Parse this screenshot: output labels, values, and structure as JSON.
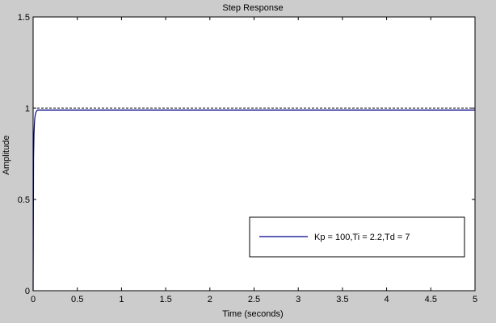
{
  "chart_data": {
    "type": "line",
    "title": "Step Response",
    "xlabel": "Time (seconds)",
    "ylabel": "Amplitude",
    "xlim": [
      0,
      5
    ],
    "ylim": [
      0,
      1.5
    ],
    "xticks": [
      0,
      0.5,
      1,
      1.5,
      2,
      2.5,
      3,
      3.5,
      4,
      4.5,
      5
    ],
    "xtick_labels": [
      "0",
      "0.5",
      "1",
      "1.5",
      "2",
      "2.5",
      "3",
      "3.5",
      "4",
      "4.5",
      "5"
    ],
    "yticks": [
      0,
      0.5,
      1,
      1.5
    ],
    "ytick_labels": [
      "0",
      "0.5",
      "1",
      "1.5"
    ],
    "grid": false,
    "legend_position": "lower-right",
    "reference_line": {
      "y": 1,
      "style": "dashed",
      "color": "#000000"
    },
    "series": [
      {
        "name": "Kp = 100,Ti = 2.2,Td = 7",
        "color": "#00008b",
        "x": [
          0,
          0.005,
          0.01,
          0.015,
          0.02,
          0.03,
          0.04,
          0.05,
          0.06,
          0.07,
          0.08,
          0.1,
          0.15,
          0.2,
          0.5,
          1,
          2,
          3,
          4,
          5
        ],
        "y": [
          0,
          0.73,
          0.86,
          0.92,
          0.95,
          0.975,
          0.985,
          0.99,
          0.99,
          0.99,
          0.99,
          0.99,
          0.99,
          0.99,
          0.99,
          0.99,
          0.99,
          0.99,
          0.99,
          0.99
        ]
      }
    ]
  },
  "colors": {
    "figure_background": "#cccccc",
    "axes_background": "#ffffff",
    "axis_color": "#000000"
  }
}
